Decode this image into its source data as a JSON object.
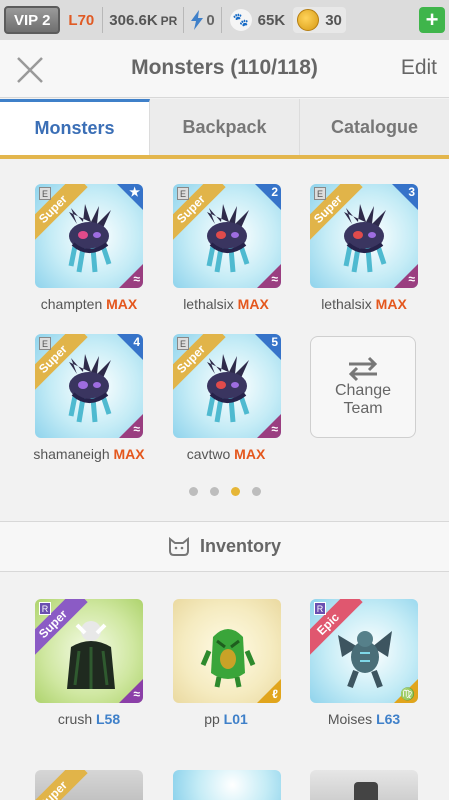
{
  "status": {
    "vip": "VIP 2",
    "level": "L70",
    "power": "306.6K",
    "power_unit": "PR",
    "energy": "0",
    "paws": "65K",
    "coins": "30"
  },
  "header": {
    "title": "Monsters (110/118)",
    "edit": "Edit"
  },
  "tabs": [
    "Monsters",
    "Backpack",
    "Catalogue"
  ],
  "team": [
    {
      "name": "champten",
      "suffix": "MAX",
      "slot": "★",
      "rarity": "Super",
      "badge": "E",
      "element": "≈"
    },
    {
      "name": "lethalsix",
      "suffix": "MAX",
      "slot": "2",
      "rarity": "Super",
      "badge": "E",
      "element": "≈"
    },
    {
      "name": "lethalsix",
      "suffix": "MAX",
      "slot": "3",
      "rarity": "Super",
      "badge": "E",
      "element": "≈"
    },
    {
      "name": "shamaneigh",
      "suffix": "MAX",
      "slot": "4",
      "rarity": "Super",
      "badge": "E",
      "element": "≈"
    },
    {
      "name": "cavtwo",
      "suffix": "MAX",
      "slot": "5",
      "rarity": "Super",
      "badge": "E",
      "element": "≈"
    }
  ],
  "change_team": {
    "line1": "Change",
    "line2": "Team"
  },
  "inventory": {
    "label": "Inventory",
    "items": [
      {
        "name": "crush",
        "level": "L58",
        "rarity": "Super",
        "badge": "R",
        "element": "≈"
      },
      {
        "name": "pp",
        "level": "L01",
        "rarity": "",
        "badge": "",
        "element": "ℓ"
      },
      {
        "name": "Moises",
        "level": "L63",
        "rarity": "Epic",
        "badge": "R",
        "element": "♍"
      }
    ],
    "partial_rarity": "Super"
  },
  "colors": {
    "accent": "#3f80c9",
    "max": "#e4571d",
    "gold": "#e3b64d",
    "add": "#3fb54b"
  }
}
